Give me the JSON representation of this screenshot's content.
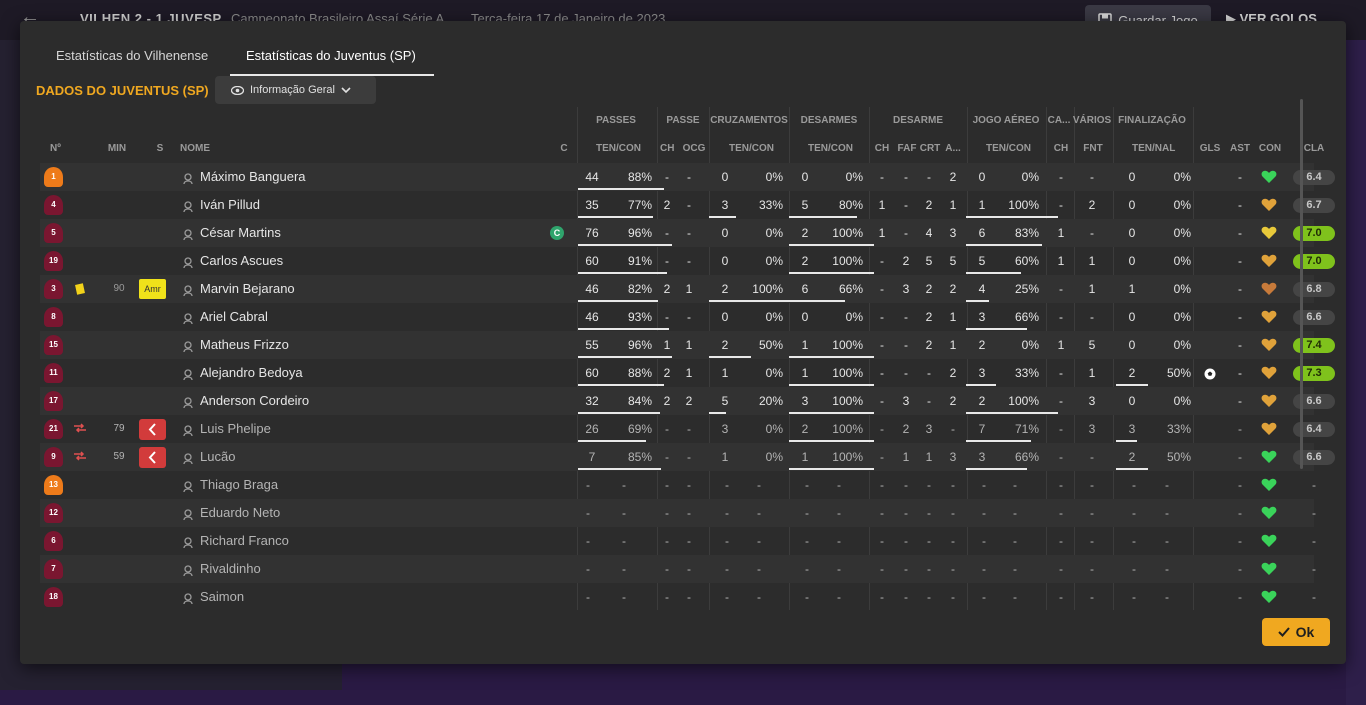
{
  "background": {
    "score": "VILHEN   2 - 1   JUVESP",
    "competition": "Campeonato Brasileiro Assaí Série A",
    "date": "Terça-feira 17 de Janeiro de 2023",
    "save_label": "Guardar Jogo",
    "goals_label": "VER GOLOS"
  },
  "tabs": [
    {
      "label": "Estatísticas do Vilhenense",
      "active": false
    },
    {
      "label": "Estatísticas do Juventus (SP)",
      "active": true
    }
  ],
  "team_title": "DADOS DO JUVENTUS (SP)",
  "view_dropdown": "Informação Geral",
  "groups": {
    "passes": "PASSES",
    "passe": "PASSE",
    "cruz": "CRUZAMENTOS",
    "desarmes": "DESARMES",
    "desarme": "DESARME",
    "aereo": "JOGO AÉREO",
    "ca": "CA...",
    "varios": "VÁRIOS",
    "final": "FINALIZAÇÃO"
  },
  "columns": {
    "num": "Nº",
    "min": "MIN",
    "s": "S",
    "nome": "NOME",
    "c": "C",
    "passes": "TEN/CON",
    "passe_ch": "CH",
    "passe_ocg": "OCG",
    "cruz": "TEN/CON",
    "desarmes": "TEN/CON",
    "desarme_ch": "CH",
    "desarme_faf": "FAF",
    "desarme_crt": "CRT",
    "desarme_a": "A...",
    "aereo": "TEN/CON",
    "ca_ch": "CH",
    "varios_fnt": "FNT",
    "final": "TEN/NAL",
    "gls": "GLS",
    "ast": "AST",
    "con": "CON",
    "cla": "CLA"
  },
  "colors": {
    "accent": "#f0a820",
    "rating_high": "#7fc21c",
    "heart_green": "#3ad35a",
    "heart_gold": "#e0a23a",
    "heart_yellow": "#e8c93a",
    "heart_brown": "#c77a3a"
  },
  "players": [
    {
      "num": "1",
      "shirt": "gk",
      "min": "",
      "card": false,
      "pos": "",
      "sub": false,
      "name": "Máximo Banguera",
      "captain": false,
      "sub_player": false,
      "p_t": "44",
      "p_c": "88%",
      "p_f": 0.88,
      "ch": "-",
      "ocg": "-",
      "cr_t": "0",
      "cr_c": "0%",
      "cr_f": 0,
      "ds_t": "0",
      "ds_c": "0%",
      "ds_f": 0,
      "d_ch": "-",
      "d_faf": "-",
      "d_crt": "-",
      "d_a": "2",
      "ae_t": "0",
      "ae_c": "0%",
      "ae_f": 0,
      "ca": "-",
      "fnt": "-",
      "fi_t": "0",
      "fi_c": "0%",
      "fi_f": 0,
      "gls": "",
      "ast": "-",
      "con": "green",
      "cla": "6.4",
      "hi": false
    },
    {
      "num": "4",
      "shirt": "out",
      "min": "",
      "card": false,
      "pos": "",
      "sub": false,
      "name": "Iván Pillud",
      "captain": false,
      "sub_player": false,
      "p_t": "35",
      "p_c": "77%",
      "p_f": 0.77,
      "ch": "2",
      "ocg": "-",
      "cr_t": "3",
      "cr_c": "33%",
      "cr_f": 0.33,
      "ds_t": "5",
      "ds_c": "80%",
      "ds_f": 0.8,
      "d_ch": "1",
      "d_faf": "-",
      "d_crt": "2",
      "d_a": "1",
      "ae_t": "1",
      "ae_c": "100%",
      "ae_f": 1,
      "ca": "-",
      "fnt": "2",
      "fi_t": "0",
      "fi_c": "0%",
      "fi_f": 0,
      "gls": "",
      "ast": "-",
      "con": "gold",
      "cla": "6.7",
      "hi": false
    },
    {
      "num": "5",
      "shirt": "out",
      "min": "",
      "card": false,
      "pos": "",
      "sub": false,
      "name": "César Martins",
      "captain": true,
      "sub_player": false,
      "p_t": "76",
      "p_c": "96%",
      "p_f": 0.96,
      "ch": "-",
      "ocg": "-",
      "cr_t": "0",
      "cr_c": "0%",
      "cr_f": 0,
      "ds_t": "2",
      "ds_c": "100%",
      "ds_f": 1,
      "d_ch": "1",
      "d_faf": "-",
      "d_crt": "4",
      "d_a": "3",
      "ae_t": "6",
      "ae_c": "83%",
      "ae_f": 0.83,
      "ca": "1",
      "fnt": "-",
      "fi_t": "0",
      "fi_c": "0%",
      "fi_f": 0,
      "gls": "",
      "ast": "-",
      "con": "yellow",
      "cla": "7.0",
      "hi": true
    },
    {
      "num": "19",
      "shirt": "out",
      "min": "",
      "card": false,
      "pos": "",
      "sub": false,
      "name": "Carlos Ascues",
      "captain": false,
      "sub_player": false,
      "p_t": "60",
      "p_c": "91%",
      "p_f": 0.91,
      "ch": "-",
      "ocg": "-",
      "cr_t": "0",
      "cr_c": "0%",
      "cr_f": 0,
      "ds_t": "2",
      "ds_c": "100%",
      "ds_f": 1,
      "d_ch": "-",
      "d_faf": "2",
      "d_crt": "5",
      "d_a": "5",
      "ae_t": "5",
      "ae_c": "60%",
      "ae_f": 0.6,
      "ca": "1",
      "fnt": "1",
      "fi_t": "0",
      "fi_c": "0%",
      "fi_f": 0,
      "gls": "",
      "ast": "-",
      "con": "gold",
      "cla": "7.0",
      "hi": true
    },
    {
      "num": "3",
      "shirt": "out",
      "min": "90",
      "card": true,
      "pos": "Amr",
      "sub": false,
      "name": "Marvin Bejarano",
      "captain": false,
      "sub_player": false,
      "p_t": "46",
      "p_c": "82%",
      "p_f": 0.82,
      "ch": "2",
      "ocg": "1",
      "cr_t": "2",
      "cr_c": "100%",
      "cr_f": 1,
      "ds_t": "6",
      "ds_c": "66%",
      "ds_f": 0.66,
      "d_ch": "-",
      "d_faf": "3",
      "d_crt": "2",
      "d_a": "2",
      "ae_t": "4",
      "ae_c": "25%",
      "ae_f": 0.25,
      "ca": "-",
      "fnt": "1",
      "fi_t": "1",
      "fi_c": "0%",
      "fi_f": 0,
      "gls": "",
      "ast": "-",
      "con": "brown",
      "cla": "6.8",
      "hi": false
    },
    {
      "num": "8",
      "shirt": "out",
      "min": "",
      "card": false,
      "pos": "",
      "sub": false,
      "name": "Ariel Cabral",
      "captain": false,
      "sub_player": false,
      "p_t": "46",
      "p_c": "93%",
      "p_f": 0.93,
      "ch": "-",
      "ocg": "-",
      "cr_t": "0",
      "cr_c": "0%",
      "cr_f": 0,
      "ds_t": "0",
      "ds_c": "0%",
      "ds_f": 0,
      "d_ch": "-",
      "d_faf": "-",
      "d_crt": "2",
      "d_a": "1",
      "ae_t": "3",
      "ae_c": "66%",
      "ae_f": 0.66,
      "ca": "-",
      "fnt": "-",
      "fi_t": "0",
      "fi_c": "0%",
      "fi_f": 0,
      "gls": "",
      "ast": "-",
      "con": "gold",
      "cla": "6.6",
      "hi": false
    },
    {
      "num": "15",
      "shirt": "out",
      "min": "",
      "card": false,
      "pos": "",
      "sub": false,
      "name": "Matheus Frizzo",
      "captain": false,
      "sub_player": false,
      "p_t": "55",
      "p_c": "96%",
      "p_f": 0.96,
      "ch": "1",
      "ocg": "1",
      "cr_t": "2",
      "cr_c": "50%",
      "cr_f": 0.5,
      "ds_t": "1",
      "ds_c": "100%",
      "ds_f": 1,
      "d_ch": "-",
      "d_faf": "-",
      "d_crt": "2",
      "d_a": "1",
      "ae_t": "2",
      "ae_c": "0%",
      "ae_f": 0,
      "ca": "1",
      "fnt": "5",
      "fi_t": "0",
      "fi_c": "0%",
      "fi_f": 0,
      "gls": "",
      "ast": "-",
      "con": "gold",
      "cla": "7.4",
      "hi": true
    },
    {
      "num": "11",
      "shirt": "out",
      "min": "",
      "card": false,
      "pos": "",
      "sub": false,
      "name": "Alejandro Bedoya",
      "captain": false,
      "sub_player": false,
      "p_t": "60",
      "p_c": "88%",
      "p_f": 0.88,
      "ch": "2",
      "ocg": "1",
      "cr_t": "1",
      "cr_c": "0%",
      "cr_f": 0,
      "ds_t": "1",
      "ds_c": "100%",
      "ds_f": 1,
      "d_ch": "-",
      "d_faf": "-",
      "d_crt": "-",
      "d_a": "2",
      "ae_t": "3",
      "ae_c": "33%",
      "ae_f": 0.33,
      "ca": "-",
      "fnt": "1",
      "fi_t": "2",
      "fi_c": "50%",
      "fi_f": 0.5,
      "gls": "ball",
      "ast": "-",
      "con": "gold",
      "cla": "7.3",
      "hi": true
    },
    {
      "num": "17",
      "shirt": "out",
      "min": "",
      "card": false,
      "pos": "",
      "sub": false,
      "name": "Anderson Cordeiro",
      "captain": false,
      "sub_player": false,
      "p_t": "32",
      "p_c": "84%",
      "p_f": 0.84,
      "ch": "2",
      "ocg": "2",
      "cr_t": "5",
      "cr_c": "20%",
      "cr_f": 0.2,
      "ds_t": "3",
      "ds_c": "100%",
      "ds_f": 1,
      "d_ch": "-",
      "d_faf": "3",
      "d_crt": "-",
      "d_a": "2",
      "ae_t": "2",
      "ae_c": "100%",
      "ae_f": 1,
      "ca": "-",
      "fnt": "3",
      "fi_t": "0",
      "fi_c": "0%",
      "fi_f": 0,
      "gls": "",
      "ast": "-",
      "con": "gold",
      "cla": "6.6",
      "hi": false
    },
    {
      "num": "21",
      "shirt": "out",
      "min": "79",
      "card": false,
      "pos": "",
      "sub": true,
      "name": "Luis Phelipe",
      "captain": false,
      "sub_player": true,
      "p_t": "26",
      "p_c": "69%",
      "p_f": 0.69,
      "ch": "-",
      "ocg": "-",
      "cr_t": "3",
      "cr_c": "0%",
      "cr_f": 0,
      "ds_t": "2",
      "ds_c": "100%",
      "ds_f": 1,
      "d_ch": "-",
      "d_faf": "2",
      "d_crt": "3",
      "d_a": "-",
      "ae_t": "7",
      "ae_c": "71%",
      "ae_f": 0.71,
      "ca": "-",
      "fnt": "3",
      "fi_t": "3",
      "fi_c": "33%",
      "fi_f": 0.33,
      "gls": "",
      "ast": "-",
      "con": "gold",
      "cla": "6.4",
      "hi": false
    },
    {
      "num": "9",
      "shirt": "out",
      "min": "59",
      "card": false,
      "pos": "",
      "sub": true,
      "name": "Lucão",
      "captain": false,
      "sub_player": true,
      "p_t": "7",
      "p_c": "85%",
      "p_f": 0.85,
      "ch": "-",
      "ocg": "-",
      "cr_t": "1",
      "cr_c": "0%",
      "cr_f": 0,
      "ds_t": "1",
      "ds_c": "100%",
      "ds_f": 1,
      "d_ch": "-",
      "d_faf": "1",
      "d_crt": "1",
      "d_a": "3",
      "ae_t": "3",
      "ae_c": "66%",
      "ae_f": 0.66,
      "ca": "-",
      "fnt": "-",
      "fi_t": "2",
      "fi_c": "50%",
      "fi_f": 0.5,
      "gls": "",
      "ast": "-",
      "con": "green",
      "cla": "6.6",
      "hi": false
    },
    {
      "num": "13",
      "shirt": "gk",
      "name": "Thiago Braga",
      "bench": true,
      "con": "green"
    },
    {
      "num": "12",
      "shirt": "out",
      "name": "Eduardo Neto",
      "bench": true,
      "con": "green"
    },
    {
      "num": "6",
      "shirt": "out",
      "name": "Richard Franco",
      "bench": true,
      "con": "green"
    },
    {
      "num": "7",
      "shirt": "out",
      "name": "Rivaldinho",
      "bench": true,
      "con": "green"
    },
    {
      "num": "18",
      "shirt": "out",
      "name": "Saimon",
      "bench": true,
      "con": "green"
    }
  ],
  "ok_label": "Ok"
}
